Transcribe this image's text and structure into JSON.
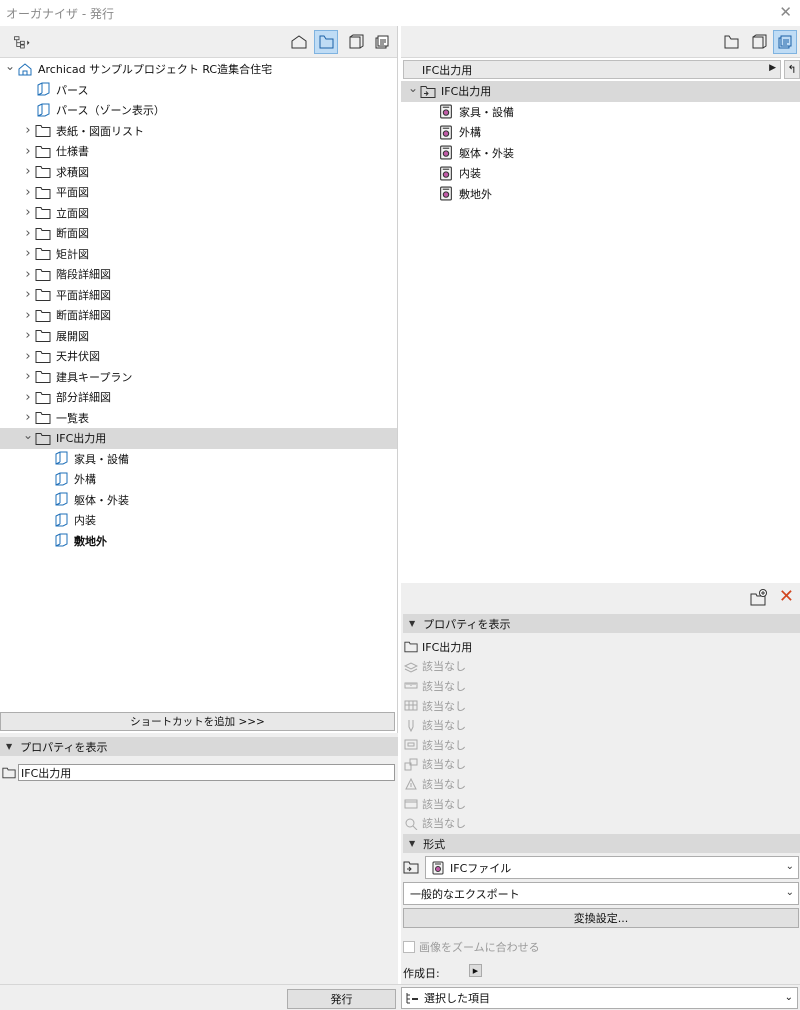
{
  "window": {
    "title": "オーガナイザ - 発行",
    "close_icon": "close-icon"
  },
  "left": {
    "toolbar": {
      "buttons": [
        "project-map-icon",
        "view-map-icon",
        "layout-book-icon",
        "publisher-sets-icon"
      ],
      "active": "view-map-icon"
    },
    "tree": [
      {
        "label": "Archicad サンプルプロジェクト RC造集合住宅",
        "icon": "project-icon",
        "level": 0,
        "expander": "open"
      },
      {
        "label": "パース",
        "icon": "view-icon",
        "level": 1,
        "expander": ""
      },
      {
        "label": "パース（ゾーン表示）",
        "icon": "view-icon",
        "level": 1,
        "expander": ""
      },
      {
        "label": "表紙・図面リスト",
        "icon": "folder-icon",
        "level": 1,
        "expander": "closed"
      },
      {
        "label": "仕様書",
        "icon": "folder-icon",
        "level": 1,
        "expander": "closed"
      },
      {
        "label": "求積図",
        "icon": "folder-icon",
        "level": 1,
        "expander": "closed"
      },
      {
        "label": "平面図",
        "icon": "folder-icon",
        "level": 1,
        "expander": "closed"
      },
      {
        "label": "立面図",
        "icon": "folder-icon",
        "level": 1,
        "expander": "closed"
      },
      {
        "label": "断面図",
        "icon": "folder-icon",
        "level": 1,
        "expander": "closed"
      },
      {
        "label": "矩計図",
        "icon": "folder-icon",
        "level": 1,
        "expander": "closed"
      },
      {
        "label": "階段詳細図",
        "icon": "folder-icon",
        "level": 1,
        "expander": "closed"
      },
      {
        "label": "平面詳細図",
        "icon": "folder-icon",
        "level": 1,
        "expander": "closed"
      },
      {
        "label": "断面詳細図",
        "icon": "folder-icon",
        "level": 1,
        "expander": "closed"
      },
      {
        "label": "展開図",
        "icon": "folder-icon",
        "level": 1,
        "expander": "closed"
      },
      {
        "label": "天井伏図",
        "icon": "folder-icon",
        "level": 1,
        "expander": "closed"
      },
      {
        "label": "建具キープラン",
        "icon": "folder-icon",
        "level": 1,
        "expander": "closed"
      },
      {
        "label": "部分詳細図",
        "icon": "folder-icon",
        "level": 1,
        "expander": "closed"
      },
      {
        "label": "一覧表",
        "icon": "folder-icon",
        "level": 1,
        "expander": "closed"
      },
      {
        "label": "IFC出力用",
        "icon": "folder-icon",
        "level": 1,
        "expander": "open",
        "selected": true
      },
      {
        "label": "家具・設備",
        "icon": "view-icon",
        "level": 2,
        "expander": ""
      },
      {
        "label": "外構",
        "icon": "view-icon",
        "level": 2,
        "expander": ""
      },
      {
        "label": "躯体・外装",
        "icon": "view-icon",
        "level": 2,
        "expander": ""
      },
      {
        "label": "内装",
        "icon": "view-icon",
        "level": 2,
        "expander": ""
      },
      {
        "label": "敷地外",
        "icon": "view-icon",
        "level": 2,
        "expander": "",
        "bold": true
      }
    ],
    "add_shortcut_label": "ショートカットを追加 >>>",
    "properties_header": "プロパティを表示",
    "name_value": "IFC出力用"
  },
  "right": {
    "toolbar": {
      "buttons": [
        "view-map-icon",
        "layout-book-icon",
        "publisher-sets-icon"
      ],
      "active": "publisher-sets-icon"
    },
    "path_label": "IFC出力用",
    "tree": [
      {
        "label": "IFC出力用",
        "icon": "publisher-folder-icon",
        "level": 0,
        "expander": "open",
        "selected": true
      },
      {
        "label": "家具・設備",
        "icon": "ifc-file-icon",
        "level": 1,
        "expander": ""
      },
      {
        "label": "外構",
        "icon": "ifc-file-icon",
        "level": 1,
        "expander": ""
      },
      {
        "label": "躯体・外装",
        "icon": "ifc-file-icon",
        "level": 1,
        "expander": ""
      },
      {
        "label": "内装",
        "icon": "ifc-file-icon",
        "level": 1,
        "expander": ""
      },
      {
        "label": "敷地外",
        "icon": "ifc-file-icon",
        "level": 1,
        "expander": ""
      }
    ],
    "properties_header": "プロパティを表示",
    "props": [
      {
        "icon": "folder-icon",
        "text": "IFC出力用",
        "gray": false
      },
      {
        "icon": "layer-icon",
        "text": "該当なし",
        "gray": true
      },
      {
        "icon": "scale-icon",
        "text": "該当なし",
        "gray": true
      },
      {
        "icon": "structure-display-icon",
        "text": "該当なし",
        "gray": true
      },
      {
        "icon": "pen-set-icon",
        "text": "該当なし",
        "gray": true
      },
      {
        "icon": "model-view-icon",
        "text": "該当なし",
        "gray": true
      },
      {
        "icon": "renovation-filter-icon",
        "text": "該当なし",
        "gray": true
      },
      {
        "icon": "graphic-override-icon",
        "text": "該当なし",
        "gray": true
      },
      {
        "icon": "dimension-icon",
        "text": "該当なし",
        "gray": true
      },
      {
        "icon": "zoom-icon",
        "text": "該当なし",
        "gray": true
      }
    ],
    "format_header": "形式",
    "format_value": "IFCファイル",
    "translator_value": "一般的なエクスポート",
    "convert_button": "変換設定...",
    "fit_zoom_label": "画像をズームに合わせる",
    "created_label": "作成日:"
  },
  "footer": {
    "publish_button": "発行",
    "selection_value": "選択した項目"
  }
}
